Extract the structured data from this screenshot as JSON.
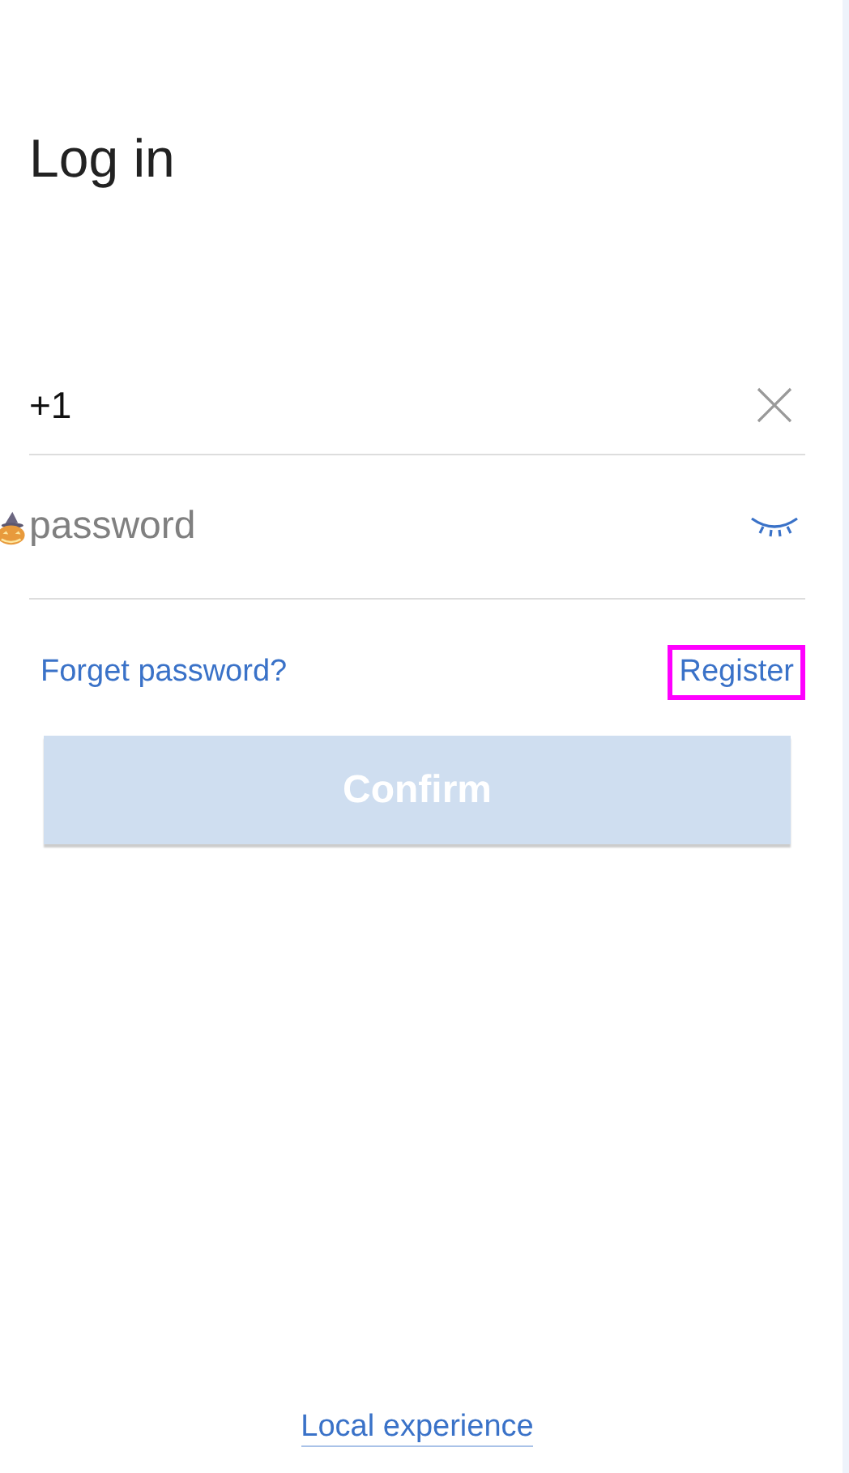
{
  "title": "Log in",
  "phone": {
    "value": "+1"
  },
  "password": {
    "placeholder": "password"
  },
  "links": [
    {
      "label": "Forget password?",
      "focused": false
    },
    {
      "label": "Register",
      "focused": true
    }
  ],
  "confirm": {
    "label": "Confirm",
    "disabled": true
  },
  "footer_link": "Local experience"
}
